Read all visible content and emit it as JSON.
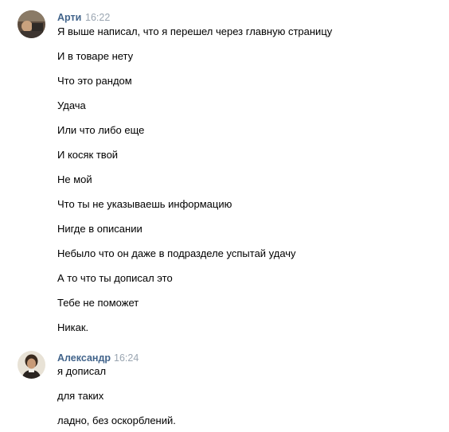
{
  "messages": [
    {
      "author": "Арти",
      "time": "16:22",
      "avatar_icon": "user-avatar-photo",
      "lines": [
        "Я выше написал, что я перешел через главную страницу",
        "И в товаре нету",
        "Что это рандом",
        "Удача",
        "Или что либо еще",
        "И косяк твой",
        "Не мой",
        "Что ты не указываешь информацию",
        "Нигде в описании",
        "Небыло что он даже в подразделе успытай удачу",
        "А то что ты дописал это",
        "Тебе не поможет",
        "Никак."
      ]
    },
    {
      "author": "Александр",
      "time": "16:24",
      "avatar_icon": "user-avatar-photo",
      "lines": [
        "я дописал",
        "для таких",
        "ладно, без оскорблений."
      ]
    }
  ],
  "colors": {
    "author": "#42648b",
    "time": "#9aa5b1",
    "text": "#000000",
    "background": "#ffffff"
  }
}
